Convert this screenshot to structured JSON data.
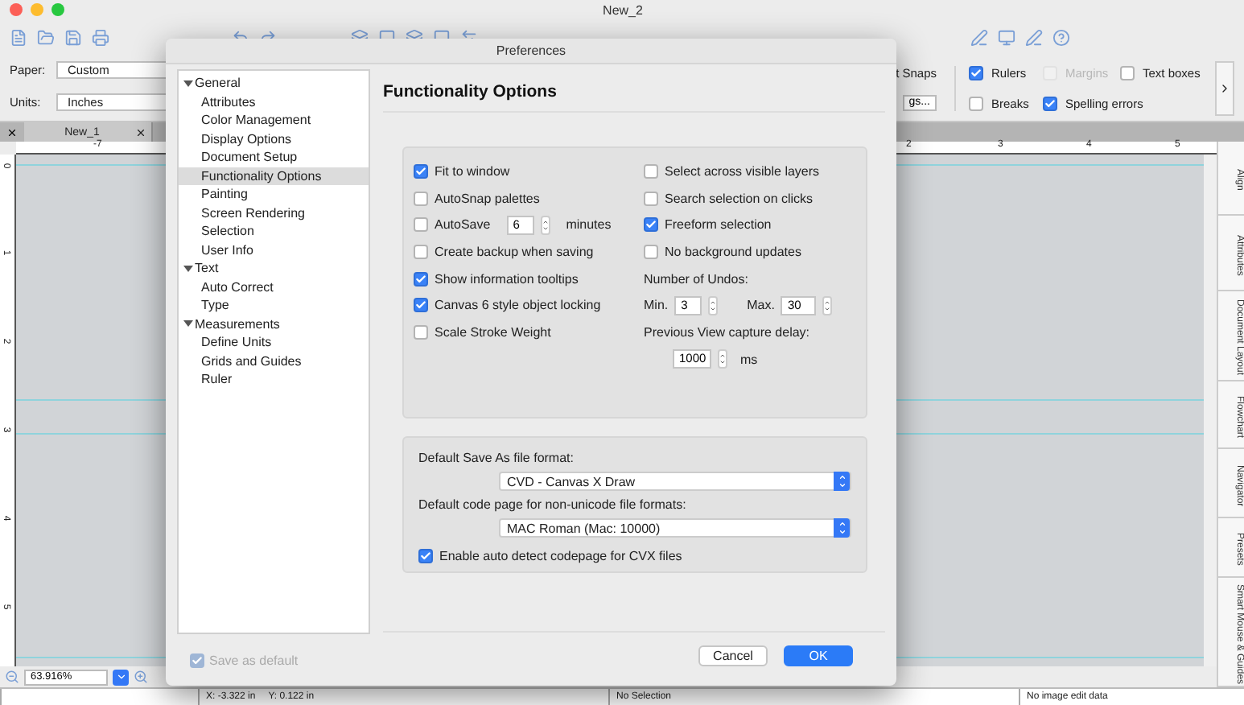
{
  "window": {
    "title": "New_2"
  },
  "options_bar": {
    "paper": {
      "label": "Paper:",
      "value": "Custom"
    },
    "units": {
      "label": "Units:",
      "value": "Inches"
    },
    "snaps_label": "t Snaps",
    "settings_button": "gs...",
    "checkboxes": [
      {
        "label": "Rulers",
        "checked": true,
        "disabled": false
      },
      {
        "label": "Margins",
        "checked": false,
        "disabled": true
      },
      {
        "label": "Text boxes",
        "checked": false,
        "disabled": false
      },
      {
        "label": "Breaks",
        "checked": false,
        "disabled": false
      },
      {
        "label": "Spelling errors",
        "checked": true,
        "disabled": false
      }
    ]
  },
  "document_tabs": [
    {
      "label": "New_1",
      "selected": true
    }
  ],
  "ruler": {
    "horizontal_labels": [
      "-7",
      "2",
      "3",
      "4",
      "5"
    ],
    "vertical_labels": [
      "0",
      "1",
      "2",
      "3",
      "4",
      "5"
    ]
  },
  "side_panel_tabs": [
    "Align",
    "Attributes",
    "Document Layout",
    "Flowchart",
    "Navigator",
    "Presets",
    "Smart Mouse & Guides"
  ],
  "zoom": {
    "value": "63.916%"
  },
  "status_bar": {
    "x": "X: -3.322 in",
    "y": "Y: 0.122 in",
    "selection": "No Selection",
    "image_info": "No image edit data"
  },
  "dialog": {
    "title": "Preferences",
    "heading": "Functionality Options",
    "sidebar": [
      {
        "label": "General",
        "expanded": true,
        "children": [
          {
            "label": "Attributes",
            "selected": false
          },
          {
            "label": "Color Management",
            "selected": false
          },
          {
            "label": "Display Options",
            "selected": false
          },
          {
            "label": "Document Setup",
            "selected": false
          },
          {
            "label": "Functionality Options",
            "selected": true
          },
          {
            "label": "Painting",
            "selected": false
          },
          {
            "label": "Screen Rendering",
            "selected": false
          },
          {
            "label": "Selection",
            "selected": false
          },
          {
            "label": "User Info",
            "selected": false
          }
        ]
      },
      {
        "label": "Text",
        "expanded": true,
        "children": [
          {
            "label": "Auto Correct",
            "selected": false
          },
          {
            "label": "Type",
            "selected": false
          }
        ]
      },
      {
        "label": "Measurements",
        "expanded": true,
        "children": [
          {
            "label": "Define Units",
            "selected": false
          },
          {
            "label": "Grids and Guides",
            "selected": false
          },
          {
            "label": "Ruler",
            "selected": false
          }
        ]
      }
    ],
    "left_options": [
      {
        "kind": "checkbox",
        "label": "Fit to window",
        "checked": true
      },
      {
        "kind": "checkbox",
        "label": "AutoSnap palettes",
        "checked": false
      },
      {
        "kind": "spin",
        "label": "AutoSave",
        "checked": false,
        "value": "6",
        "unit": "minutes"
      },
      {
        "kind": "checkbox",
        "label": "Create backup when saving",
        "checked": false
      },
      {
        "kind": "checkbox",
        "label": "Show information tooltips",
        "checked": true
      },
      {
        "kind": "checkbox",
        "label": "Canvas 6 style object locking",
        "checked": true
      },
      {
        "kind": "checkbox",
        "label": "Scale Stroke Weight",
        "checked": false
      }
    ],
    "right_options": [
      {
        "label": "Select across visible layers",
        "checked": false
      },
      {
        "label": "Search selection on clicks",
        "checked": false
      },
      {
        "label": "Freeform selection",
        "checked": true
      },
      {
        "label": "No background updates",
        "checked": false
      }
    ],
    "undos": {
      "label": "Number of Undos:",
      "min_label": "Min.",
      "min": "3",
      "max_label": "Max.",
      "max": "30"
    },
    "capture_delay": {
      "label": "Previous View capture delay:",
      "value": "1000",
      "unit": "ms"
    },
    "save_format": {
      "label": "Default Save As file format:",
      "value": "CVD - Canvas X Draw"
    },
    "code_page": {
      "label": "Default code page for non-unicode file formats:",
      "value": "MAC Roman (Mac: 10000)"
    },
    "auto_detect": {
      "label": "Enable auto detect codepage for CVX files",
      "checked": true
    },
    "save_default": {
      "label": "Save as default",
      "checked": true,
      "disabled": true
    },
    "buttons": [
      {
        "label": "Cancel",
        "kind": "secondary"
      },
      {
        "label": "OK",
        "kind": "primary"
      }
    ]
  }
}
